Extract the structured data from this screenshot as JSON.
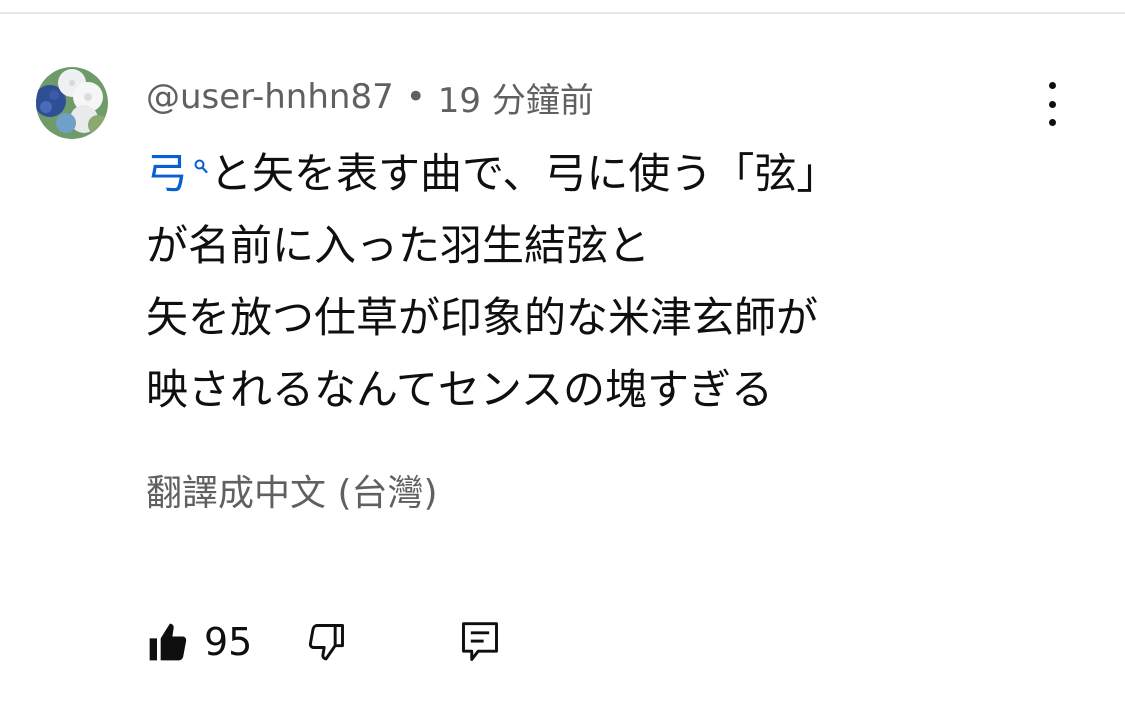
{
  "comment": {
    "author": "@user-hnhn87",
    "separator": "•",
    "time_ago": "19 分鐘前",
    "search_term": "弓",
    "body_line1_rest": "と矢を表す曲で、弓に使う「弦」",
    "body_line2": "が名前に入った羽生結弦と",
    "body_line3": "矢を放つ仕草が印象的な米津玄師が",
    "body_line4": "映されるなんてセンスの塊すぎる",
    "translate_label": "翻譯成中文 (台灣)",
    "like_count": "95"
  },
  "colors": {
    "link": "#065fd4",
    "secondary_text": "#606060",
    "primary_text": "#0f0f0f"
  },
  "icons": {
    "more": "more-vertical-icon",
    "like": "thumbs-up-filled-icon",
    "dislike": "thumbs-down-outline-icon",
    "reply": "comment-reply-icon",
    "search": "search-icon"
  }
}
